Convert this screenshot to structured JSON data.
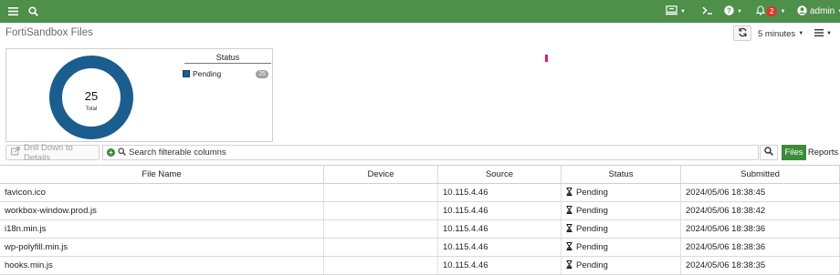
{
  "topbar": {
    "menu_icon": "hamburger-icon",
    "search_icon": "search-icon",
    "device_icon": "device-icon",
    "console_icon": "console-icon",
    "help_icon": "help-icon",
    "bell_icon": "bell-icon",
    "notification_count": "2",
    "user_icon": "user-icon",
    "username": "admin",
    "bar_color": "#4e8f4a"
  },
  "page": {
    "title": "FortiSandbox Files",
    "refresh_icon": "refresh-icon",
    "interval": "5 minutes",
    "options_icon": "hamburger-icon"
  },
  "chart_data": {
    "type": "pie",
    "style": "donut",
    "center_value": "25",
    "center_label": "Total",
    "legend_title": "Status",
    "slices": [
      {
        "label": "Pending",
        "value": 25,
        "color": "#1c5d8f"
      }
    ]
  },
  "toolbar": {
    "drill_label": "Drill Down to Details",
    "filter_placeholder": "Search filterable columns",
    "files_tab": "Files",
    "reports_tab": "Reports",
    "accent": "#3c8a3a"
  },
  "table": {
    "headers": [
      "File Name",
      "Device",
      "Source",
      "Status",
      "Submitted"
    ],
    "rows": [
      {
        "file": "favicon.ico",
        "device": "",
        "source": "10.115.4.46",
        "status": "Pending",
        "submitted": "2024/05/06 18:38:45"
      },
      {
        "file": "workbox-window.prod.js",
        "device": "",
        "source": "10.115.4.46",
        "status": "Pending",
        "submitted": "2024/05/06 18:38:42"
      },
      {
        "file": "i18n.min.js",
        "device": "",
        "source": "10.115.4.46",
        "status": "Pending",
        "submitted": "2024/05/06 18:38:36"
      },
      {
        "file": "wp-polyfill.min.js",
        "device": "",
        "source": "10.115.4.46",
        "status": "Pending",
        "submitted": "2024/05/06 18:38:36"
      },
      {
        "file": "hooks.min.js",
        "device": "",
        "source": "10.115.4.46",
        "status": "Pending",
        "submitted": "2024/05/06 18:38:35"
      }
    ]
  }
}
